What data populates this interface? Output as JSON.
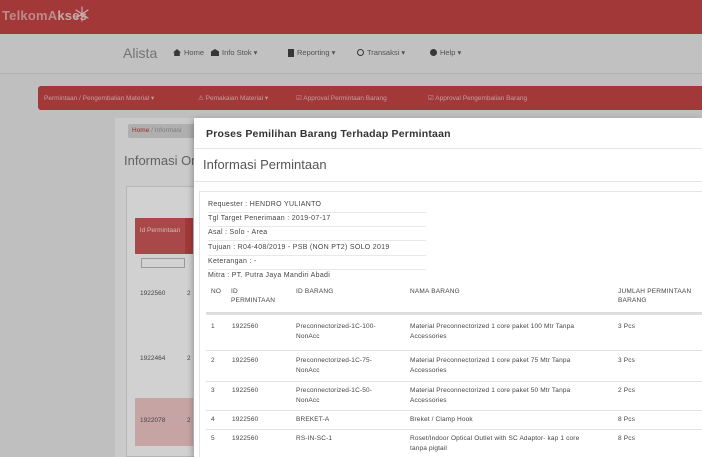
{
  "brand": {
    "logo_part1": "TelkomA",
    "logo_part2": "kses"
  },
  "nav": {
    "app_name": "Alista",
    "items": [
      {
        "label": "Home",
        "icon": "home-icon"
      },
      {
        "label": "Info Stok ▾",
        "icon": "bank-icon"
      },
      {
        "label": "Reporting ▾",
        "icon": "document-icon"
      },
      {
        "label": "Transaksi ▾",
        "icon": "search-icon"
      },
      {
        "label": "Help ▾",
        "icon": "help-icon"
      }
    ]
  },
  "submenu": {
    "items": [
      {
        "label": "Permintaan / Pengembalian Material ▾"
      },
      {
        "label": "⚠  Pemakaian Material ▾"
      },
      {
        "label": "☑  Approval Permintaan Barang"
      },
      {
        "label": "☑  Approval Pengembalian Barang"
      }
    ]
  },
  "background": {
    "breadcrumb_home": "Home",
    "breadcrumb_rest": " / Informasi",
    "heading": "Informasi Or",
    "col_header": "Id Permintaan",
    "rows": [
      {
        "id": "1922560",
        "c2": "2"
      },
      {
        "id": "1922464",
        "c2": "2"
      },
      {
        "id": "1922078",
        "c2": "2"
      }
    ]
  },
  "modal": {
    "title": "Proses Pemilihan Barang Terhadap Permintaan",
    "section_title": "Informasi Permintaan",
    "info": {
      "requester": "Requester : HENDRO YULIANTO",
      "tgl_target": "Tgl Target Penerimaan : 2019-07-17",
      "asal": "Asal : Solo - Area",
      "tujuan": "Tujuan : R04-408/2019 - PSB (NON PT2) SOLO 2019",
      "keterangan": "Keterangan : -",
      "mitra": "Mitra : PT. Putra Jaya Mandiri Abadi"
    },
    "table": {
      "headers": {
        "no": "NO",
        "id_permintaan_1": "ID",
        "id_permintaan_2": "PERMINTAAN",
        "id_barang": "ID BARANG",
        "nama_barang": "NAMA BARANG",
        "jumlah_1": "JUMLAH PERMINTAAN",
        "jumlah_2": "BARANG"
      },
      "rows": [
        {
          "no": "1",
          "id_permintaan": "1922560",
          "id_barang_1": "Preconnectorized-1C-100-",
          "id_barang_2": "NonAcc",
          "nama_1": "Material Preconnectorized 1 core paket 100 Mtr Tanpa",
          "nama_2": "Accessories",
          "jumlah": "3 Pcs"
        },
        {
          "no": "2",
          "id_permintaan": "1922560",
          "id_barang_1": "Preconnectorized-1C-75-",
          "id_barang_2": "NonAcc",
          "nama_1": "Material Preconnectorized 1 core paket 75 Mtr Tanpa",
          "nama_2": "Accessories",
          "jumlah": "3 Pcs"
        },
        {
          "no": "3",
          "id_permintaan": "1922560",
          "id_barang_1": "Preconnectorized-1C-50-",
          "id_barang_2": "NonAcc",
          "nama_1": "Material Preconnectorized 1 core paket 50 Mtr Tanpa",
          "nama_2": "Accessories",
          "jumlah": "2 Pcs"
        },
        {
          "no": "4",
          "id_permintaan": "1922560",
          "id_barang_1": "BREKET-A",
          "id_barang_2": "",
          "nama_1": "Breket / Clamp Hook",
          "nama_2": "",
          "jumlah": "8 Pcs"
        },
        {
          "no": "5",
          "id_permintaan": "1922560",
          "id_barang_1": "RS-IN-SC-1",
          "id_barang_2": "",
          "nama_1": "Roset/Indoor Optical Outlet with SC Adaptor- kap 1 core",
          "nama_2": "tanpa pigtail",
          "jumlah": "8 Pcs"
        }
      ]
    }
  },
  "colors": {
    "brand_red": "#c64545",
    "header_red": "#cf5858",
    "highlight_row": "#f2c9c9"
  }
}
